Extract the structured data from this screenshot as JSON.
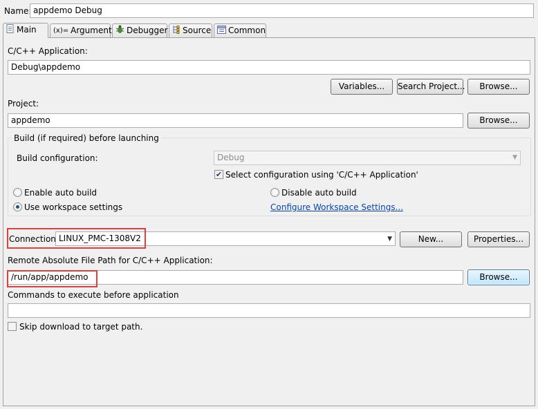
{
  "name": {
    "label": "Name:",
    "value": "appdemo Debug"
  },
  "tabs": [
    {
      "label": "Main",
      "icon": "main-tab-icon"
    },
    {
      "label": "Arguments",
      "icon": "variable-x-icon"
    },
    {
      "label": "Debugger",
      "icon": "bug-icon"
    },
    {
      "label": "Source",
      "icon": "source-icon"
    },
    {
      "label": "Common",
      "icon": "common-icon"
    }
  ],
  "application": {
    "label": "C/C++ Application:",
    "value": "Debug\\appdemo",
    "variables_button": "Variables...",
    "search_button": "Search Project...",
    "browse_button": "Browse..."
  },
  "project": {
    "label": "Project:",
    "value": "appdemo",
    "browse_button": "Browse..."
  },
  "build": {
    "group_title": "Build (if required) before launching",
    "config_label": "Build configuration:",
    "config_value": "Debug",
    "select_config_label": "Select configuration using 'C/C++ Application'",
    "select_config_checked": true,
    "enable_auto": "Enable auto build",
    "disable_auto": "Disable auto build",
    "use_workspace": "Use workspace settings",
    "configure_link": "Configure Workspace Settings..."
  },
  "connection": {
    "label": "Connection:",
    "value": "LINUX_PMC-1308V2",
    "new_button": "New...",
    "properties_button": "Properties..."
  },
  "remote": {
    "label": "Remote Absolute File Path for C/C++ Application:",
    "value": "/run/app/appdemo",
    "browse_button": "Browse..."
  },
  "commands": {
    "label": "Commands to execute before application",
    "value": ""
  },
  "skip": {
    "label": "Skip download to target path.",
    "checked": false
  },
  "colors": {
    "highlight": "#d9423a",
    "link": "#0645ad"
  }
}
